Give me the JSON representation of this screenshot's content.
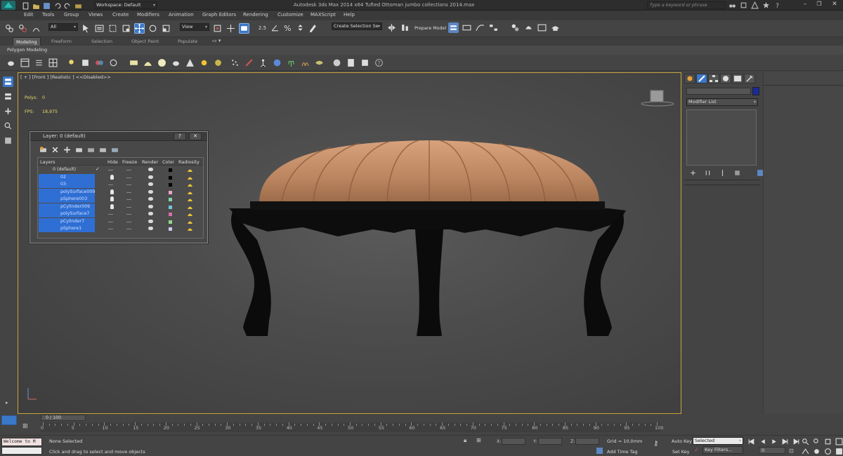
{
  "window": {
    "title": "Autodesk 3ds Max  2014 x64     Tufted Ottoman jumbo collections 2014.max",
    "workspace_label": "Workspace: Default",
    "search_placeholder": "Type a keyword or phrase"
  },
  "menu": [
    "Edit",
    "Tools",
    "Group",
    "Views",
    "Create",
    "Modifiers",
    "Animation",
    "Graph Editors",
    "Rendering",
    "Customize",
    "MAXScript",
    "Help"
  ],
  "main_toolbar": {
    "selection_filter": "All",
    "ref_coord": "View",
    "named_selection": "Create Selection Se",
    "prepare_model": "Prepare Model",
    "snap_25": "2.5"
  },
  "ribbon": {
    "tabs": [
      "Modeling",
      "Freeform",
      "Selection",
      "Object Paint",
      "Populate"
    ],
    "active_tab": "Modeling",
    "sub_label": "Polygon Modeling"
  },
  "viewport": {
    "label": "[ + ] [Front ] [Realistic ]  <<Disabled>>",
    "stats": {
      "polys_label": "Polys:",
      "polys_value": "0",
      "fps_label": "FPS:",
      "fps_value": "18,975"
    }
  },
  "layer_dialog": {
    "title": "Layer: 0 (default)",
    "help_btn": "?",
    "close_btn": "✕",
    "columns": [
      "Layers",
      "Hide",
      "Freeze",
      "Render",
      "Color",
      "Radiosity"
    ],
    "rows": [
      {
        "name": "0 (default)",
        "color": "#000000",
        "default": true
      },
      {
        "name": "02",
        "color": "#000000"
      },
      {
        "name": "03",
        "color": "#000000"
      },
      {
        "name": "polySurface009",
        "color": "#e8a6c8"
      },
      {
        "name": "pSphere003",
        "color": "#7fd6a8"
      },
      {
        "name": "pCylinder009",
        "color": "#6fc8d8"
      },
      {
        "name": "polySurface7",
        "color": "#d86fb0"
      },
      {
        "name": "pCylinder7",
        "color": "#8fd88f"
      },
      {
        "name": "pSphere1",
        "color": "#c8c8f0"
      }
    ]
  },
  "command_panel": {
    "modifier_list": "Modifier List"
  },
  "timeline": {
    "frame_counter": "0 / 100",
    "ticks": [
      "0",
      "5",
      "10",
      "15",
      "20",
      "25",
      "30",
      "35",
      "40",
      "45",
      "50",
      "55",
      "60",
      "65",
      "70",
      "75",
      "80",
      "85",
      "90",
      "95",
      "100"
    ]
  },
  "status": {
    "maxscript_text": "Welcome to M",
    "selection_text": "None Selected",
    "prompt_text": "Click and drag to select and move objects",
    "x_label": "X:",
    "y_label": "Y:",
    "z_label": "Z:",
    "grid_text": "Grid = 10,0mm",
    "add_time_tag": "Add Time Tag",
    "auto_key": "Auto Key",
    "set_key": "Set Key",
    "selected_dd": "Selected",
    "key_filters": "Key Filters...",
    "frame_field": "0"
  },
  "colors": {
    "accent_blue": "#2f6fd4",
    "viewport_border": "#c9a33a",
    "ottoman_top": "#c8906a",
    "ottoman_base": "#0d0d0d"
  }
}
